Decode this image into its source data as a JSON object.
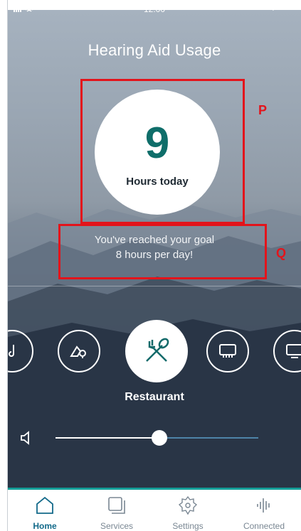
{
  "status_bar": {
    "time": "12:00"
  },
  "header": {
    "title": "Hearing Aid Usage"
  },
  "usage": {
    "hours": "9",
    "label": "Hours today"
  },
  "goal": {
    "line1": "You've reached your goal",
    "line2": "8 hours per day!"
  },
  "annotations": {
    "p": "P",
    "q": "Q"
  },
  "programs": {
    "items": [
      {
        "name": "music",
        "icon": "music-note-icon",
        "active": false
      },
      {
        "name": "outdoor",
        "icon": "outdoor-icon",
        "active": false
      },
      {
        "name": "restaurant",
        "icon": "fork-spoon-icon",
        "active": true
      },
      {
        "name": "theater",
        "icon": "theater-icon",
        "active": false
      },
      {
        "name": "tv",
        "icon": "tv-icon",
        "active": false
      }
    ],
    "selected_label": "Restaurant"
  },
  "volume": {
    "level": 0.5
  },
  "tabbar": {
    "tabs": [
      {
        "label": "Home",
        "icon": "home-icon",
        "active": true
      },
      {
        "label": "Services",
        "icon": "services-icon",
        "active": false
      },
      {
        "label": "Settings",
        "icon": "gear-icon",
        "active": false
      },
      {
        "label": "Connected",
        "icon": "waveform-icon",
        "active": false
      }
    ]
  },
  "colors": {
    "accent": "#149e98",
    "number": "#0f6e6a",
    "annotation": "#e3141b",
    "active_tab": "#136a8a"
  }
}
